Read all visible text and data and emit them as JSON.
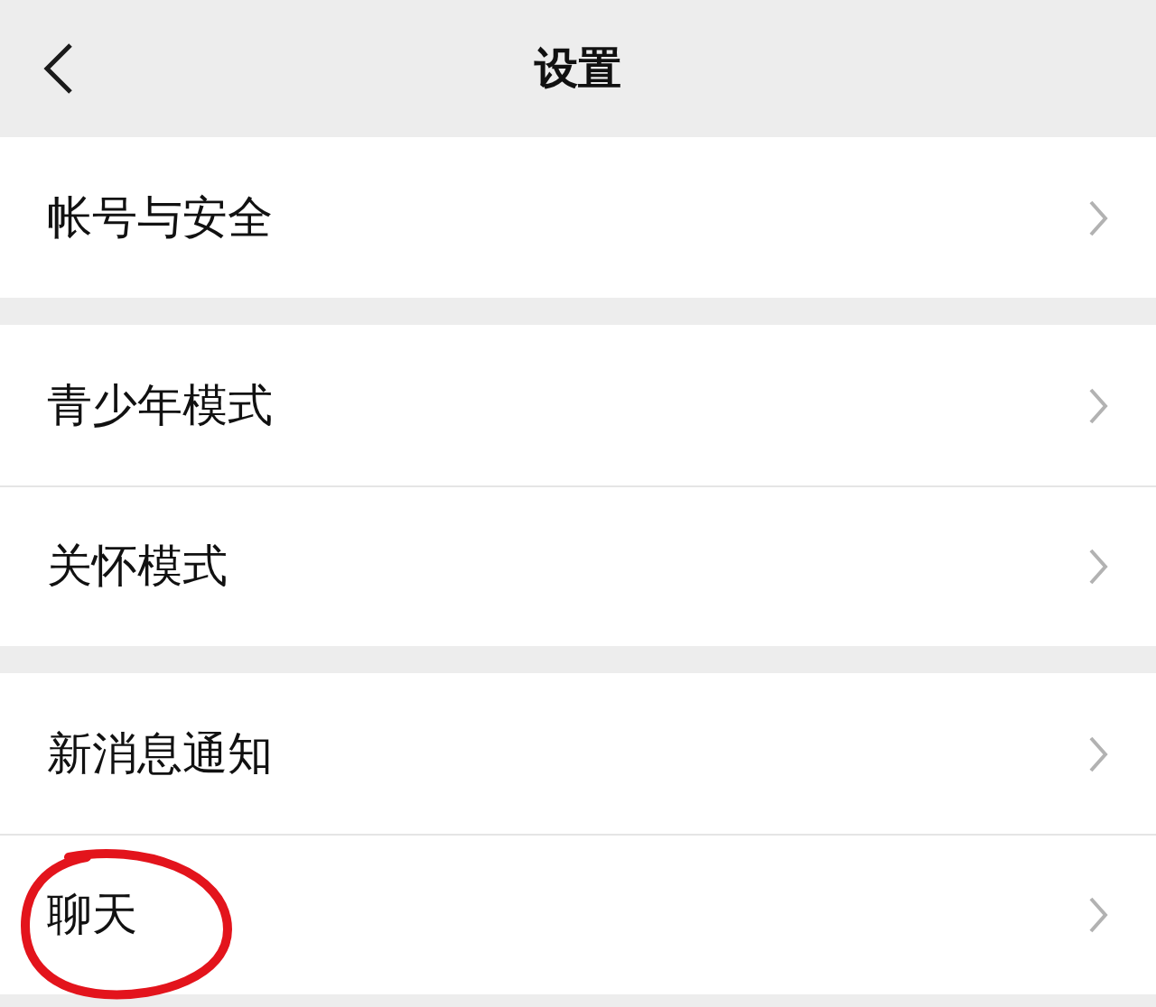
{
  "header": {
    "title": "设置"
  },
  "groups": [
    {
      "items": [
        {
          "label": "帐号与安全",
          "circled": false
        }
      ]
    },
    {
      "items": [
        {
          "label": "青少年模式",
          "circled": false
        },
        {
          "label": "关怀模式",
          "circled": false
        }
      ]
    },
    {
      "items": [
        {
          "label": "新消息通知",
          "circled": false
        },
        {
          "label": "聊天",
          "circled": true
        }
      ]
    }
  ]
}
